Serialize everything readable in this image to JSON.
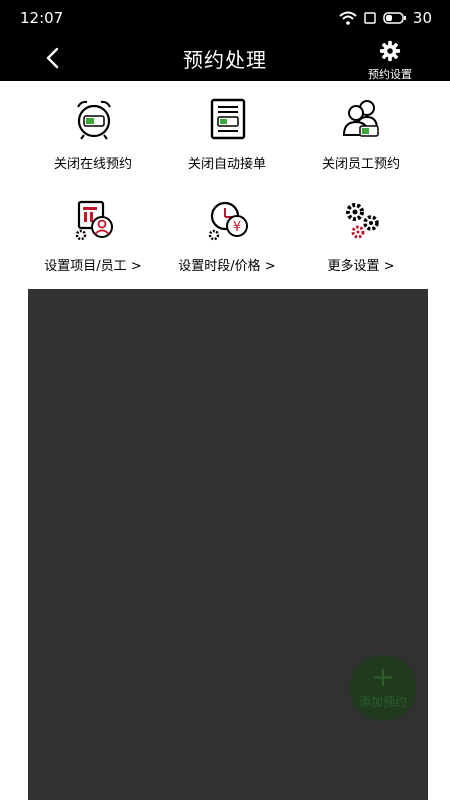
{
  "status": {
    "time": "12:07",
    "battery": "30"
  },
  "header": {
    "title": "预约处理",
    "settings_label": "预约设置"
  },
  "actions": [
    {
      "label": "关闭在线预约"
    },
    {
      "label": "关闭自动接单"
    },
    {
      "label": "关闭员工预约"
    },
    {
      "label": "设置项目/员工 >"
    },
    {
      "label": "设置时段/价格 >"
    },
    {
      "label": "更多设置 >"
    }
  ],
  "fab": {
    "label": "添加预约"
  },
  "colors": {
    "accent_green": "#3aa93a",
    "accent_red": "#c0162a",
    "header_bg": "#000000",
    "content_bg": "#313131"
  }
}
